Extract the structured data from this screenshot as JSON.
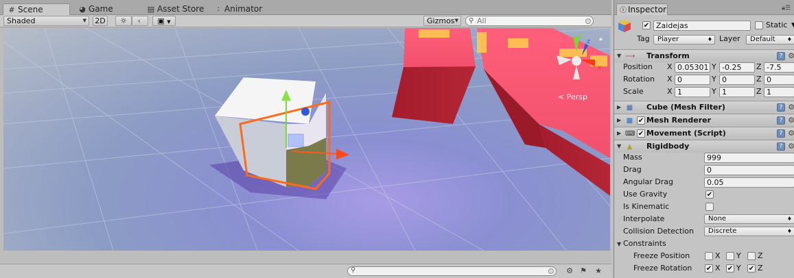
{
  "scene_tabs": [
    {
      "label": "Scene",
      "icon": "hash-icon",
      "active": true
    },
    {
      "label": "Game",
      "icon": "pacman-icon",
      "active": false
    },
    {
      "label": "Asset Store",
      "icon": "store-icon",
      "active": false
    },
    {
      "label": "Animator",
      "icon": "animator-icon",
      "active": false
    }
  ],
  "toolbar": {
    "shading_mode": "Shaded",
    "mode_2d": "2D",
    "gizmos": "Gizmos",
    "search_placeholder": "All"
  },
  "viewport": {
    "persp_label": "Persp",
    "gizmo_axes": {
      "x": "x",
      "y": "y",
      "z": "z"
    }
  },
  "inspector": {
    "tab_label": "Inspector",
    "object": {
      "active": true,
      "name": "Zaidejas",
      "static_label": "Static",
      "static": false,
      "tag_label": "Tag",
      "tag": "Player",
      "layer_label": "Layer",
      "layer": "Default"
    },
    "transform": {
      "title": "Transform",
      "position": {
        "label": "Position",
        "x": "0.05301",
        "y": "-0.25",
        "z": "-7.5"
      },
      "rotation": {
        "label": "Rotation",
        "x": "0",
        "y": "0",
        "z": "0"
      },
      "scale": {
        "label": "Scale",
        "x": "1",
        "y": "1",
        "z": "1"
      }
    },
    "components": [
      {
        "title": "Cube (Mesh Filter)",
        "has_checkbox": false
      },
      {
        "title": "Mesh Renderer",
        "has_checkbox": true,
        "enabled": true
      },
      {
        "title": "Movement (Script)",
        "has_checkbox": true,
        "enabled": true
      }
    ],
    "rigidbody": {
      "title": "Rigidbody",
      "mass_label": "Mass",
      "mass": "999",
      "drag_label": "Drag",
      "drag": "0",
      "angular_drag_label": "Angular Drag",
      "angular_drag": "0.05",
      "use_gravity_label": "Use Gravity",
      "use_gravity": true,
      "is_kinematic_label": "Is Kinematic",
      "is_kinematic": false,
      "interpolate_label": "Interpolate",
      "interpolate": "None",
      "collision_label": "Collision Detection",
      "collision": "Discrete",
      "constraints_label": "Constraints",
      "freeze_position_label": "Freeze Position",
      "freeze_position": {
        "x": false,
        "y": false,
        "z": false
      },
      "freeze_rotation_label": "Freeze Rotation",
      "freeze_rotation": {
        "x": true,
        "y": true,
        "z": true
      }
    },
    "axis_labels": {
      "x": "X",
      "y": "Y",
      "z": "Z"
    }
  }
}
